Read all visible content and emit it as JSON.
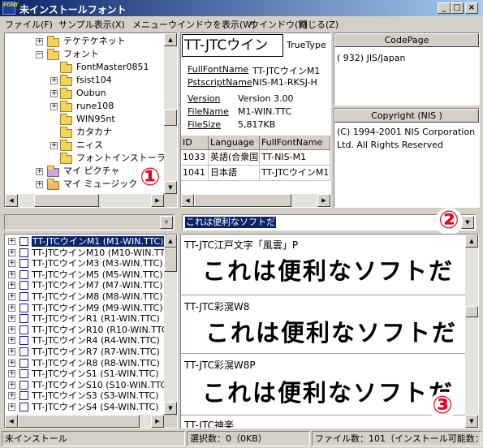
{
  "window": {
    "icon_text": "FONT",
    "title": "未インストールフォント",
    "min_label": "_",
    "max_label": "□",
    "close_label": "×"
  },
  "menu": {
    "items": [
      "ファイル(F)",
      "サンプル表示(X)",
      "メニューウインドウを表示(W)",
      "ウインドウ(Y)",
      "閉じる(Z)"
    ]
  },
  "tree": {
    "items": [
      {
        "label": "テケテケネット",
        "expander": "+"
      },
      {
        "label": "フォント",
        "expander": "−"
      },
      {
        "label": "FontMaster0851",
        "expander": ""
      },
      {
        "label": "fsist104",
        "expander": "+"
      },
      {
        "label": "Oubun",
        "expander": "+"
      },
      {
        "label": "rune108",
        "expander": "+"
      },
      {
        "label": "WIN95nt",
        "expander": ""
      },
      {
        "label": "カタカナ",
        "expander": ""
      },
      {
        "label": "ニィス",
        "expander": "+"
      },
      {
        "label": "フォントインストーラーS",
        "expander": ""
      },
      {
        "label": "マイ ピクチャ",
        "expander": "+"
      },
      {
        "label": "マイ ミュージック",
        "expander": "+"
      }
    ]
  },
  "font_info": {
    "preview_label": "TT-JTCウイン",
    "type_label": "TrueType",
    "fields": [
      {
        "key": "FullFontName",
        "value": "TT-JTCウインM1"
      },
      {
        "key": "PstscriptName",
        "value": "NIS-M1-RKSJ-H"
      },
      {
        "key": "Version",
        "value": "Version 3.00"
      },
      {
        "key": "FileName",
        "value": "M1-WIN.TTC"
      },
      {
        "key": "FileSize",
        "value": "5,817KB"
      }
    ],
    "table_headers": [
      "ID",
      "Language",
      "FullFontName"
    ],
    "table_rows": [
      [
        "1033",
        "英語(合衆国)",
        "TT-NIS-M1"
      ],
      [
        "1041",
        "日本語",
        "TT-JTCウインM1"
      ]
    ]
  },
  "codepage": {
    "header": "CodePage",
    "value": "( 932) JIS/Japan"
  },
  "copyright": {
    "header": "Copyright (NIS )",
    "line1": "(C) 1994-2001 NIS Corporation",
    "line2": "Ltd. All Rights Reserved"
  },
  "sample_text_combo": {
    "value": "これは便利なソフトだ"
  },
  "font_list": {
    "items": [
      "TT-JTCウインM1  (M1-WIN.TTC)",
      "TT-JTCウインM10  (M10-WIN.TTC)",
      "TT-JTCウインM3  (M3-WIN.TTC)",
      "TT-JTCウインM5  (M5-WIN.TTC)",
      "TT-JTCウインM7  (M7-WIN.TTC)",
      "TT-JTCウインM8  (M8-WIN.TTC)",
      "TT-JTCウインM9  (M9-WIN.TTC)",
      "TT-JTCウインR1  (R1-WIN.TTC)",
      "TT-JTCウインR10  (R10-WIN.TTC)",
      "TT-JTCウインR4  (R4-WIN.TTC)",
      "TT-JTCウインR7  (R7-WIN.TTC)",
      "TT-JTCウインR8  (R8-WIN.TTC)",
      "TT-JTCウインS1  (S1-WIN.TTC)",
      "TT-JTCウインS10  (S10-WIN.TTC)",
      "TT-JTCウインS3  (S3-WIN.TTC)",
      "TT-JTCウインS4  (S4-WIN.TTC)"
    ]
  },
  "preview": {
    "items": [
      {
        "font_name": "TT-JTC江戸文字「風雲」P",
        "sample": "これは便利なソフトだ"
      },
      {
        "font_name": "TT-JTC彩滉W8",
        "sample": "これは便利なソフトだ"
      },
      {
        "font_name": "TT-JTC彩滉W8P",
        "sample": "これは便利なソフトだ"
      },
      {
        "font_name": "TT-JTC神楽",
        "sample": ""
      }
    ]
  },
  "badges": [
    "①",
    "②",
    "③"
  ],
  "status": {
    "left": "未インストール",
    "selected": "選択数：0（0KB）",
    "file_count": "ファイル数：101（インストール可能数："
  },
  "colors": {
    "title_gradient_start": "#0a246a",
    "title_gradient_end": "#a6caf0",
    "selection": "#0a246a",
    "badge_red": "#e8001c",
    "face": "#d4d0c8"
  }
}
